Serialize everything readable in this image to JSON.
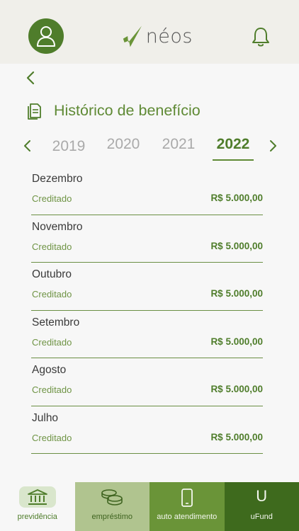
{
  "header": {
    "logo_text": "néos",
    "avatar_icon": "user-icon",
    "notifications_icon": "bell-icon"
  },
  "page": {
    "back_icon": "chevron-left-icon",
    "title_icon": "document-icon",
    "title": "Histórico de benefício"
  },
  "years": {
    "items": [
      "2019",
      "2020",
      "2021",
      "2022"
    ],
    "selected": "2022"
  },
  "history": [
    {
      "month": "Dezembro",
      "status": "Creditado",
      "amount": "R$ 5.000,00"
    },
    {
      "month": "Novembro",
      "status": "Creditado",
      "amount": "R$ 5.000,00"
    },
    {
      "month": "Outubro",
      "status": "Creditado",
      "amount": "R$ 5.000,00"
    },
    {
      "month": "Setembro",
      "status": "Creditado",
      "amount": "R$ 5.000,00"
    },
    {
      "month": "Agosto",
      "status": "Creditado",
      "amount": "R$ 5.000,00"
    },
    {
      "month": "Julho",
      "status": "Creditado",
      "amount": "R$ 5.000,00"
    }
  ],
  "nav": [
    {
      "label": "previdência",
      "icon": "bank-icon"
    },
    {
      "label": "empréstimo",
      "icon": "coins-icon"
    },
    {
      "label": "auto atendimento",
      "icon": "phone-icon"
    },
    {
      "label": "uFund",
      "icon": "ufund-icon",
      "glyph": "U"
    }
  ],
  "colors": {
    "brand_green": "#4f7d2b",
    "title_green": "#5f8a35",
    "nav_bg_2": "#b0c48f",
    "nav_bg_3": "#6a9438",
    "nav_bg_4": "#3e6a1d"
  }
}
